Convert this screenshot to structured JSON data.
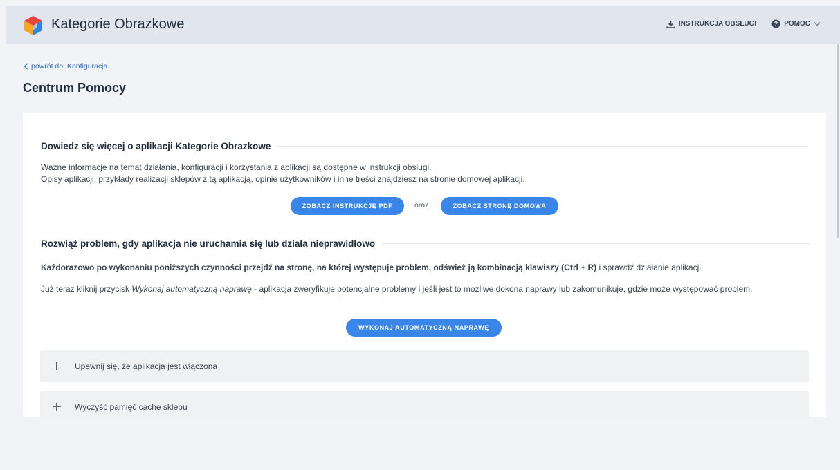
{
  "header": {
    "app_title": "Kategorie Obrazkowe",
    "manual_label": "INSTRUKCJA OBSŁUGI",
    "help_label": "POMOC"
  },
  "nav": {
    "back_label": "powrót do: Konfiguracja"
  },
  "page": {
    "title": "Centrum Pomocy"
  },
  "about": {
    "heading": "Dowiedz się więcej o aplikacji Kategorie Obrazkowe",
    "line1": "Ważne informacje na temat działania, konfiguracji i korzystania z aplikacji są dostępne w instrukcji obsługi.",
    "line2": "Opisy aplikacji, przykłady realizacji sklepów z tą aplikacją, opinie użytkowników i inne treści znajdziesz na stronie domowej aplikacji.",
    "pdf_button": "ZOBACZ INSTRUKCJĘ PDF",
    "and_label": "oraz",
    "home_button": "ZOBACZ STRONĘ DOMOWĄ"
  },
  "troubleshoot": {
    "heading": "Rozwiąż problem, gdy aplikacja nie uruchamia się lub działa nieprawidłowo",
    "bold_text": "Każdorazowo po wykonaniu poniższych czynności przejdź na stronę, na której występuje problem, odśwież ją kombinacją klawiszy (Ctrl + R)",
    "bold_tail": " i sprawdź działanie aplikacji.",
    "auto_prefix": "Już teraz kliknij przycisk ",
    "auto_italic": "Wykonaj automatyczną naprawę",
    "auto_suffix": " - aplikacja zweryfikuje potencjalne problemy i jeśli jest to możliwe dokona naprawy lub zakomunikuje, gdzie może występować problem.",
    "repair_button": "WYKONAJ AUTOMATYCZNĄ NAPRAWĘ",
    "items": [
      {
        "label": "Upewnij się, że aplikacja jest włączona"
      },
      {
        "label": "Wyczyść pamięć cache sklepu"
      }
    ]
  },
  "colors": {
    "accent": "#3a85e8",
    "header_bg": "#e1e6ee",
    "link": "#2d6fd0"
  },
  "icons": [
    "app-logo-icon",
    "download-icon",
    "help-icon",
    "chevron-down-icon",
    "chevron-left-icon",
    "plus-icon"
  ]
}
